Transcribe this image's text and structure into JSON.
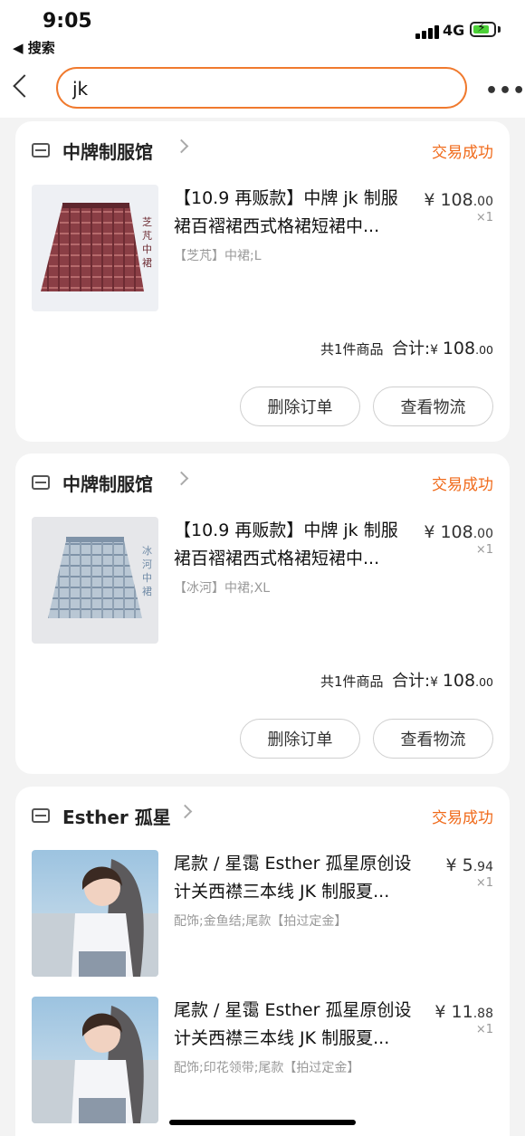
{
  "status_bar": {
    "time": "9:05",
    "back_app": "◀ 搜索",
    "network": "4G"
  },
  "search": {
    "query": "jk",
    "more_label": "•••"
  },
  "colors": {
    "accent": "#f06a1a",
    "search_border": "#f07a2e"
  },
  "orders": [
    {
      "shop": "中牌制服馆",
      "status": "交易成功",
      "items": [
        {
          "title_line1": "【10.9 再贩款】中牌 jk 制服",
          "title_line2": "裙百褶裙西式格裙短裙中...",
          "sku": "【芝芃】中裙;L",
          "price_int": "108",
          "price_dec": ".00",
          "qty": "×1",
          "thumb_caption": "芝芃中裙"
        }
      ],
      "summary_count": "共1件商品",
      "summary_label": "合计:",
      "summary_price": "108",
      "summary_dec": ".00",
      "btn_delete": "删除订单",
      "btn_logistics": "查看物流"
    },
    {
      "shop": "中牌制服馆",
      "status": "交易成功",
      "items": [
        {
          "title_line1": "【10.9 再贩款】中牌 jk 制服",
          "title_line2": "裙百褶裙西式格裙短裙中...",
          "sku": "【冰河】中裙;XL",
          "price_int": "108",
          "price_dec": ".00",
          "qty": "×1",
          "thumb_caption": "冰河中裙"
        }
      ],
      "summary_count": "共1件商品",
      "summary_label": "合计:",
      "summary_price": "108",
      "summary_dec": ".00",
      "btn_delete": "删除订单",
      "btn_logistics": "查看物流"
    },
    {
      "shop": "Esther 孤星",
      "status": "交易成功",
      "items": [
        {
          "title_line1": "尾款 / 星霭 Esther 孤星原创设",
          "title_line2": "计关西襟三本线 JK 制服夏...",
          "sku": "配饰;金鱼结;尾款【拍过定金】",
          "price_int": "5",
          "price_dec": ".94",
          "qty": "×1"
        },
        {
          "title_line1": "尾款 / 星霭 Esther 孤星原创设",
          "title_line2": "计关西襟三本线 JK 制服夏...",
          "sku": "配饰;印花领带;尾款【拍过定金】",
          "price_int": "11",
          "price_dec": ".88",
          "qty": "×1"
        }
      ]
    }
  ]
}
